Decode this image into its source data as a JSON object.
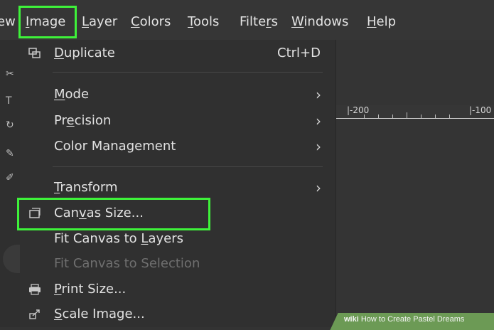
{
  "menubar": {
    "items": [
      {
        "pre": "",
        "mn": "",
        "post": "ew"
      },
      {
        "pre": "",
        "mn": "I",
        "post": "mage"
      },
      {
        "pre": "",
        "mn": "L",
        "post": "ayer"
      },
      {
        "pre": "",
        "mn": "C",
        "post": "olors"
      },
      {
        "pre": "",
        "mn": "T",
        "post": "ools"
      },
      {
        "pre": "Filte",
        "mn": "r",
        "post": "s"
      },
      {
        "pre": "",
        "mn": "W",
        "post": "indows"
      },
      {
        "pre": "",
        "mn": "H",
        "post": "elp"
      }
    ]
  },
  "menu": {
    "duplicate": {
      "pre": "",
      "mn": "D",
      "post": "uplicate",
      "shortcut": "Ctrl+D",
      "icon": "duplicate-icon"
    },
    "mode": {
      "pre": "",
      "mn": "M",
      "post": "ode"
    },
    "precision": {
      "pre": "Pr",
      "mn": "e",
      "post": "cision"
    },
    "color_management": {
      "label": "Color Management"
    },
    "transform": {
      "pre": "",
      "mn": "T",
      "post": "ransform"
    },
    "canvas_size": {
      "pre": "Can",
      "mn": "v",
      "post": "as Size...",
      "icon": "canvas-size-icon"
    },
    "fit_canvas_layers": {
      "pre": "Fit Canvas to ",
      "mn": "L",
      "post": "ayers"
    },
    "fit_canvas_selection": {
      "label": "Fit Canvas to Selection",
      "disabled": true
    },
    "print_size": {
      "pre": "",
      "mn": "P",
      "post": "rint Size...",
      "icon": "printer-icon"
    },
    "scale_image": {
      "pre": "",
      "mn": "S",
      "post": "cale Image...",
      "icon": "scale-image-icon"
    }
  },
  "ruler": {
    "labels": [
      "|-200",
      "|-100"
    ]
  },
  "watermark": {
    "brand": "wiki",
    "text": "How to Create Pastel Dreams"
  },
  "colors": {
    "highlight": "#3ef23a",
    "menu_bg": "#303030",
    "bar_bg": "#363636"
  }
}
